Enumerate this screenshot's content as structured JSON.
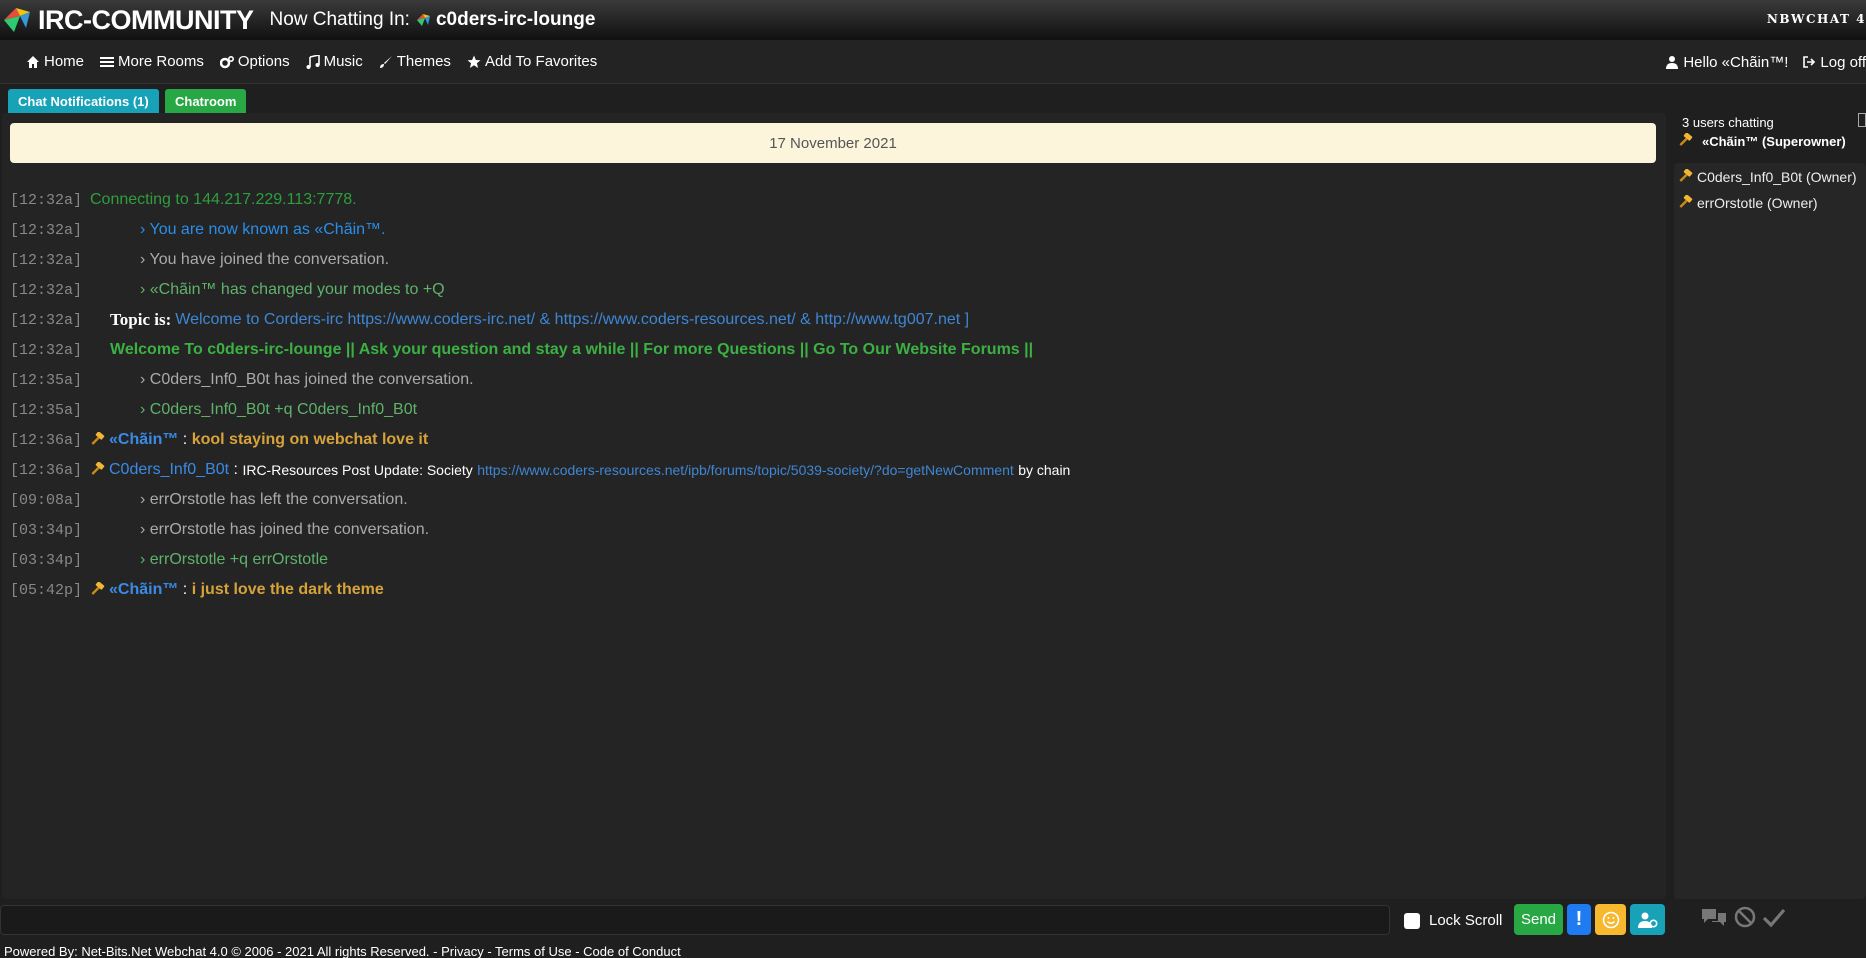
{
  "app": {
    "brand": "IRC-COMMUNITY",
    "chatting_label": "Now Chatting In:",
    "room": "c0ders-irc-lounge",
    "brand_right": "NBWCHAT 4"
  },
  "nav": {
    "home": "Home",
    "more_rooms": "More Rooms",
    "options": "Options",
    "music": "Music",
    "themes": "Themes",
    "favorites": "Add To Favorites",
    "hello": "Hello «Chãin™!",
    "logoff": "Log off"
  },
  "tabs": {
    "notifications": "Chat Notifications (1)",
    "chatroom": "Chatroom"
  },
  "chat": {
    "date": "17 November 2021",
    "messages": [
      {
        "ts": "[12:32a]",
        "text": "Connecting to 144.217.229.113:7778."
      },
      {
        "ts": "[12:32a]",
        "text": "› You are now known as «Chãin™."
      },
      {
        "ts": "[12:32a]",
        "text": "› You have joined the conversation."
      },
      {
        "ts": "[12:32a]",
        "text": "› «Chãin™ has changed your modes to +Q"
      },
      {
        "ts": "[12:32a]",
        "label": "Topic is:",
        "text": "Welcome to Corders-irc",
        "link1": "https://www.coders-irc.net/",
        "sep1": "&",
        "link2": "https://www.coders-resources.net/",
        "sep2": "&",
        "link3": "http://www.tg007.net",
        "end": "]"
      },
      {
        "ts": "[12:32a]",
        "text": "Welcome To c0ders-irc-lounge || Ask your question and stay a while || For more Questions || Go To Our Website Forums ||"
      },
      {
        "ts": "[12:35a]",
        "text": "› C0ders_Inf0_B0t has joined the conversation."
      },
      {
        "ts": "[12:35a]",
        "text": "› C0ders_Inf0_B0t +q C0ders_Inf0_B0t"
      },
      {
        "ts": "[12:36a]",
        "user": "«Chãin™",
        "sep": ":",
        "text": "kool staying on webchat love it"
      },
      {
        "ts": "[12:36a]",
        "user": "C0ders_Inf0_B0t",
        "sep": ":",
        "text": "IRC-Resources Post Update: Society",
        "link": "https://www.coders-resources.net/ipb/forums/topic/5039-society/?do=getNewComment",
        "after": "by chain"
      },
      {
        "ts": "[09:08a]",
        "text": "› errOrstotle has left the conversation."
      },
      {
        "ts": "[03:34p]",
        "text": "› errOrstotle has joined the conversation."
      },
      {
        "ts": "[03:34p]",
        "text": "› errOrstotle +q errOrstotle"
      },
      {
        "ts": "[05:42p]",
        "user": "«Chãin™",
        "sep": ":",
        "text": "i just love the dark theme"
      }
    ]
  },
  "sidebar": {
    "users_count": "3 users chatting",
    "superowner": "«Chãin™ (Superowner)",
    "users": [
      "C0ders_Inf0_B0t (Owner)",
      "errOrstotle (Owner)"
    ]
  },
  "bottom": {
    "lock_scroll": "Lock Scroll",
    "send": "Send",
    "alert": "!",
    "footer": "Powered By: Net-Bits.Net Webchat 4.0 © 2006 - 2021 All rights Reserved. - Privacy - Terms of Use - Code of Conduct"
  },
  "colors": {
    "accent_green": "#28a745",
    "accent_teal": "#17a2b8",
    "accent_blue": "#1f7bf2",
    "accent_yellow": "#f5b82e"
  }
}
